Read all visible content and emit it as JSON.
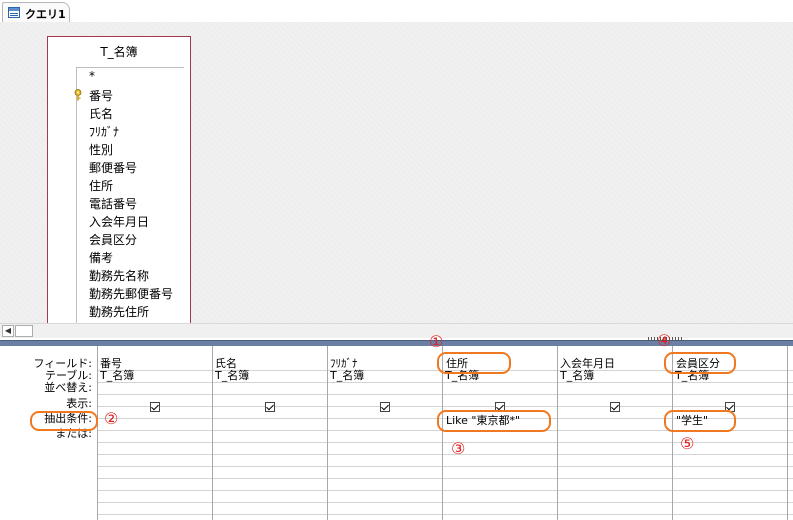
{
  "tab": {
    "label": "クエリ1"
  },
  "table": {
    "name": "T_名簿",
    "fields": [
      "*",
      "番号",
      "氏名",
      "ﾌﾘｶﾞﾅ",
      "性別",
      "郵便番号",
      "住所",
      "電話番号",
      "入会年月日",
      "会員区分",
      "備考",
      "勤務先名称",
      "勤務先郵便番号",
      "勤務先住所"
    ]
  },
  "grid": {
    "row_labels": [
      "フィールド:",
      "テーブル:",
      "並べ替え:",
      "表示:",
      "抽出条件:",
      "または:"
    ],
    "columns": [
      {
        "field": "番号",
        "table": "T_名簿",
        "show": true,
        "criteria": ""
      },
      {
        "field": "氏名",
        "table": "T_名簿",
        "show": true,
        "criteria": ""
      },
      {
        "field": "ﾌﾘｶﾞﾅ",
        "table": "T_名簿",
        "show": true,
        "criteria": ""
      },
      {
        "field": "住所",
        "table": "T_名簿",
        "show": true,
        "criteria": "Like \"東京都*\""
      },
      {
        "field": "入会年月日",
        "table": "T_名簿",
        "show": true,
        "criteria": ""
      },
      {
        "field": "会員区分",
        "table": "T_名簿",
        "show": true,
        "criteria": "\"学生\""
      }
    ]
  },
  "annotations": {
    "n1": "①",
    "n2": "②",
    "n3": "③",
    "n4": "④",
    "n5": "⑤"
  },
  "colors": {
    "highlight": "#f07820",
    "number": "#e02020",
    "table_border": "#a23a4c",
    "splitter": "#6a7fa3"
  }
}
